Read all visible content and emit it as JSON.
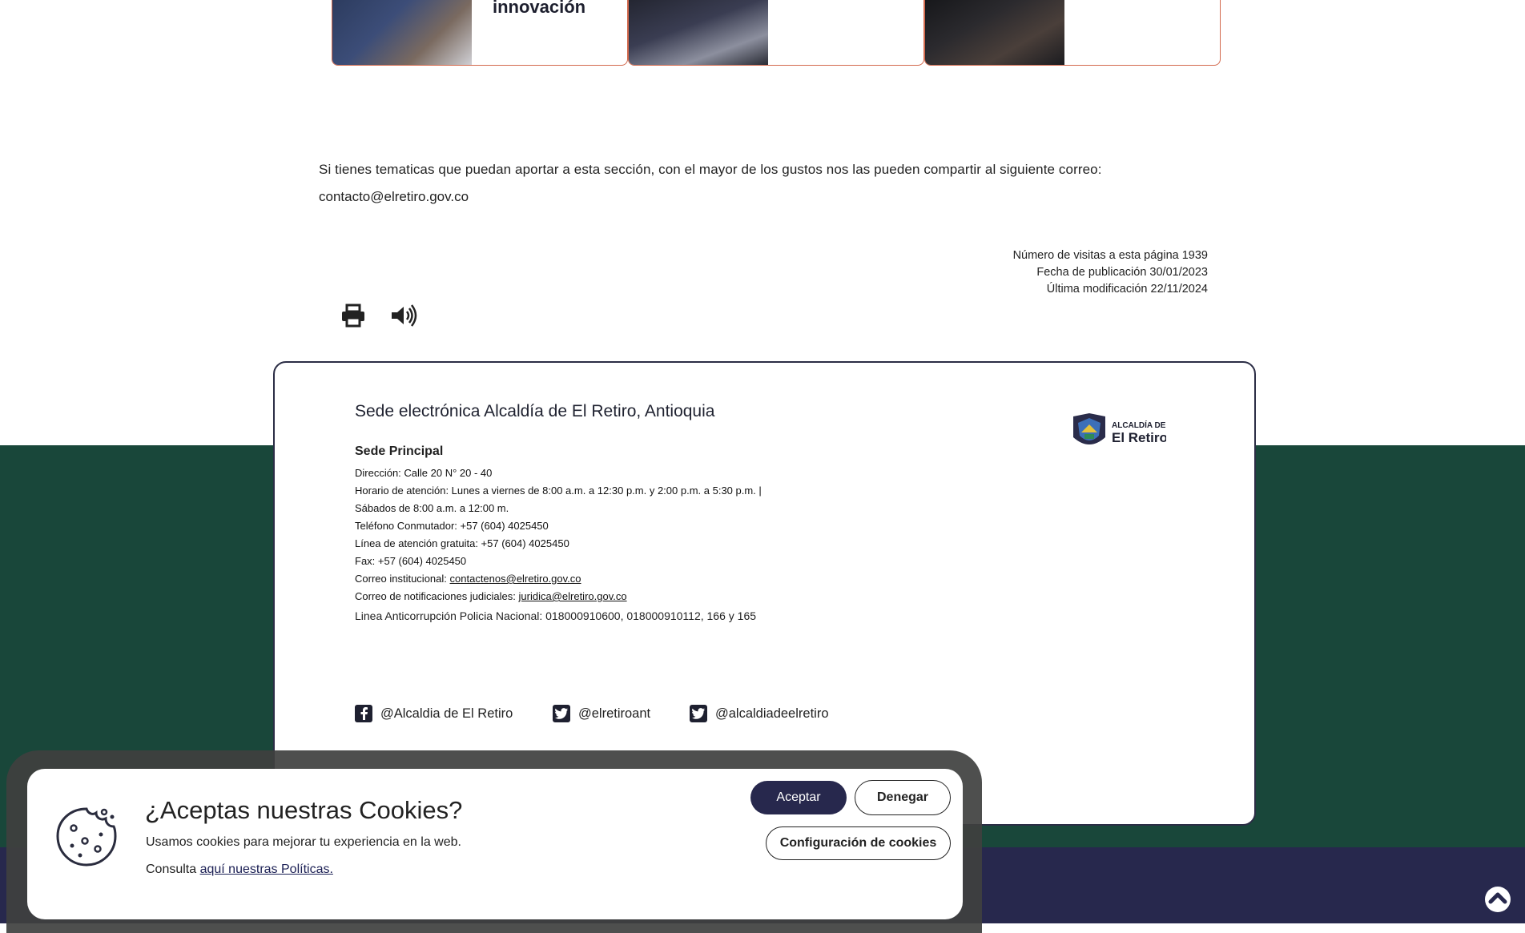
{
  "cards": [
    {
      "title": "innovación"
    },
    {
      "title": ""
    },
    {
      "title": ""
    }
  ],
  "intro": {
    "text": "Si tienes tematicas que puedan aportar a esta sección, con el mayor de los gustos nos las pueden compartir al siguiente correo:",
    "email": "contacto@elretiro.gov.co"
  },
  "meta": {
    "visits": "Número de visitas a esta página 1939",
    "published": "Fecha de publicación 30/01/2023",
    "modified": "Última modificación 22/11/2024"
  },
  "tools": {
    "print_icon": "print-icon",
    "audio_icon": "speaker-icon"
  },
  "footer": {
    "title": "Sede electrónica Alcaldía de El Retiro, Antioquia",
    "logo_top": "ALCALDÍA DE",
    "logo_main": "El Retiro",
    "subtitle": "Sede Principal",
    "address": "Dirección: Calle 20 N° 20 - 40",
    "hours": "Horario de atención: Lunes a viernes de 8:00 a.m. a 12:30 p.m. y 2:00 p.m. a 5:30 p.m. | Sábados de 8:00 a.m. a 12:00 m.",
    "phone": "Teléfono Conmutador: +57 (604) 4025450",
    "free_line": "Línea de atención gratuita: +57 (604) 4025450",
    "fax": "Fax: +57 (604) 4025450",
    "inst_email_label": "Correo institucional:",
    "inst_email": "contactenos@elretiro.gov.co",
    "judicial_label": "Correo de notificaciones judiciales:",
    "judicial_email": "juridica@elretiro.gov.co",
    "anticorruption": "Linea Anticorrupción Policia Nacional: 018000910600, 018000910112, 166 y 165"
  },
  "social": [
    {
      "icon": "facebook-icon",
      "label": "@Alcaldia de El Retiro"
    },
    {
      "icon": "twitter-icon",
      "label": "@elretiroant"
    },
    {
      "icon": "twitter-icon",
      "label": "@alcaldiadeelretiro"
    }
  ],
  "cookies": {
    "title": "¿Aceptas nuestras Cookies?",
    "text": "Usamos cookies para mejorar tu experiencia en la web.",
    "policy_prefix": "Consulta ",
    "policy_link": "aquí nuestras Políticas.",
    "accept": "Aceptar",
    "deny": "Denegar",
    "config": "Configuración de cookies"
  },
  "colors": {
    "green": "#19473a",
    "navy": "#27284d",
    "card_border": "#d36a4e"
  }
}
